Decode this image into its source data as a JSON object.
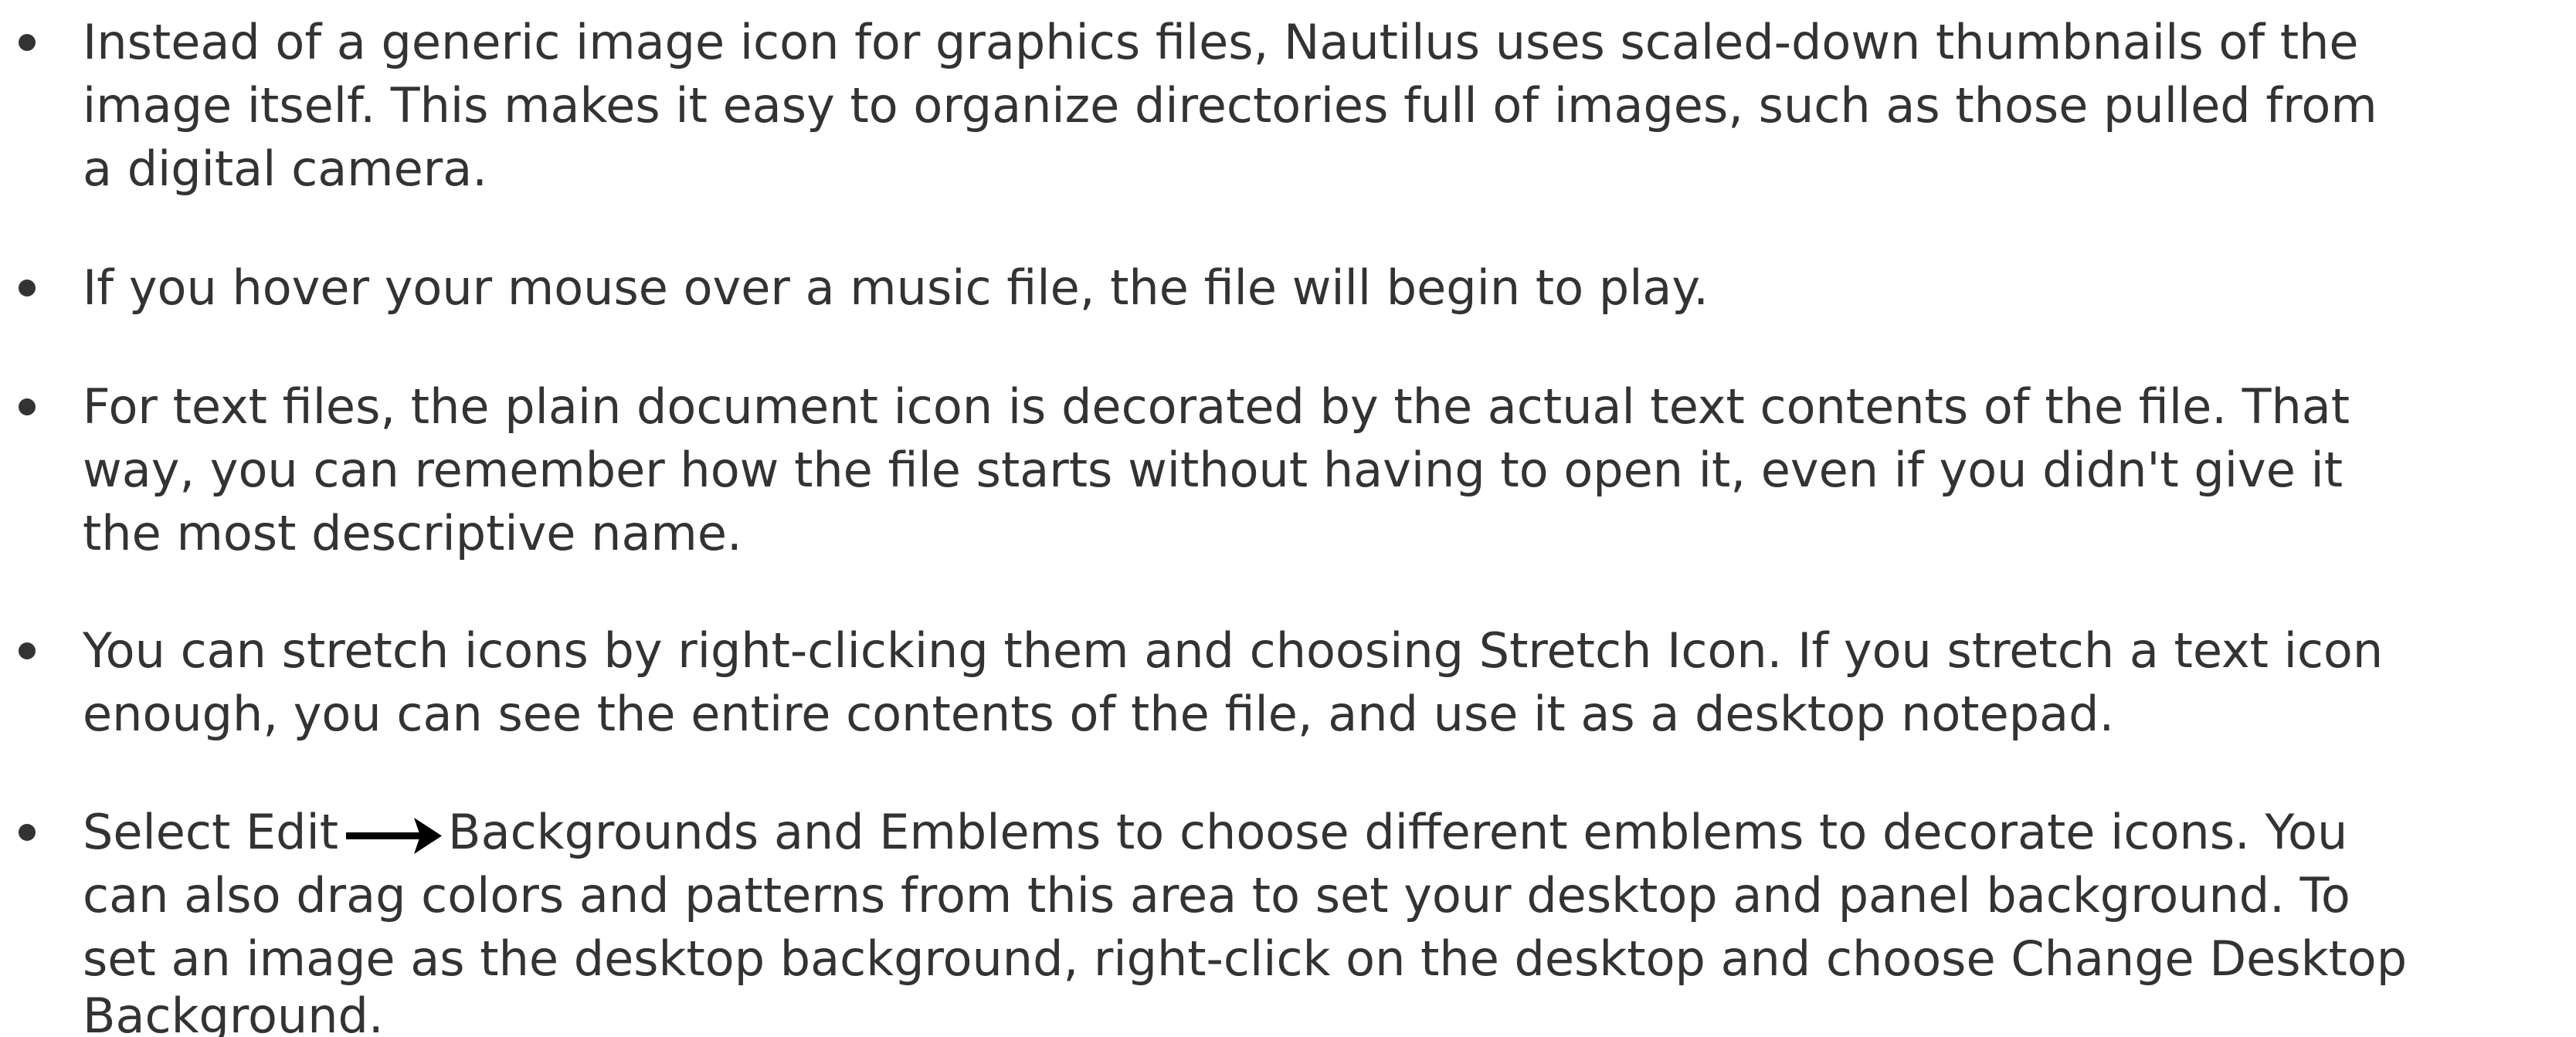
{
  "tips": [
    {
      "lines": [
        "Instead of a generic image icon for graphics files, Nautilus uses scaled-down thumbnails of the",
        "image itself. This makes it easy to organize directories full of images, such as those pulled from",
        "a digital camera."
      ]
    },
    {
      "lines": [
        "If you hover your mouse over a music file, the file will begin to play."
      ]
    },
    {
      "lines": [
        "For text files, the plain document icon is decorated by the actual text contents of the file. That",
        "way, you can remember how the file starts without having to open it, even if you didn't give it",
        "the most descriptive name."
      ]
    },
    {
      "lines": [
        "You can stretch icons by right-clicking them and choosing Stretch Icon. If you stretch a text icon",
        "enough, you can see the entire contents of the file, and use it as a desktop notepad."
      ]
    },
    {
      "first_line_before_arrow": "Select Edit",
      "first_line_after_arrow": "Backgrounds and Emblems to choose different emblems to decorate icons. You",
      "arrow_icon": "right-arrow-icon",
      "lines": [
        "can also drag colors and patterns from this area to set your desktop and panel background. To",
        "set an image as the desktop background, right-click on the desktop and choose Change Desktop",
        "Background."
      ]
    }
  ],
  "colors": {
    "text": "#333333",
    "background": "#ffffff"
  }
}
